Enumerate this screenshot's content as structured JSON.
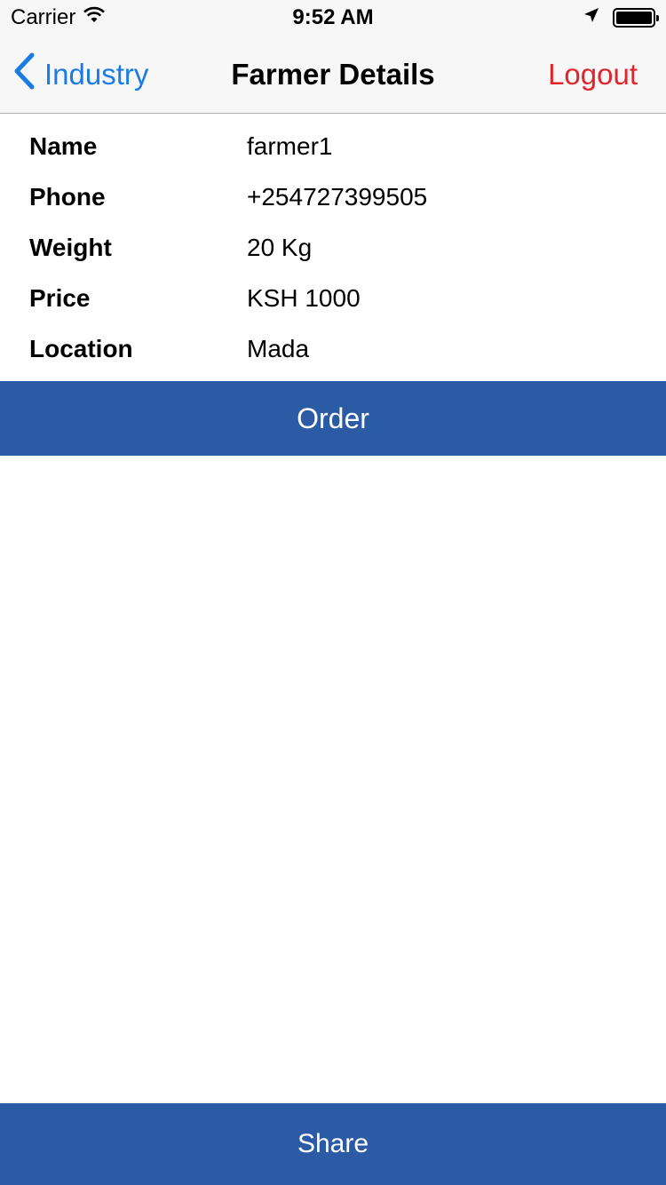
{
  "status_bar": {
    "carrier": "Carrier",
    "time": "9:52 AM",
    "icons": [
      "wifi-icon",
      "location-arrow-icon",
      "battery-icon"
    ]
  },
  "nav": {
    "back_label": "Industry",
    "title": "Farmer Details",
    "logout_label": "Logout",
    "colors": {
      "back": "#1a7ce3",
      "logout": "#e0262b"
    }
  },
  "details": [
    {
      "label": "Name",
      "value": "farmer1"
    },
    {
      "label": "Phone",
      "value": "+254727399505"
    },
    {
      "label": "Weight",
      "value": "20 Kg"
    },
    {
      "label": "Price",
      "value": "KSH 1000"
    },
    {
      "label": "Location",
      "value": "Mada"
    }
  ],
  "actions": {
    "order_label": "Order",
    "share_label": "Share",
    "button_color": "#2b5ba4"
  }
}
